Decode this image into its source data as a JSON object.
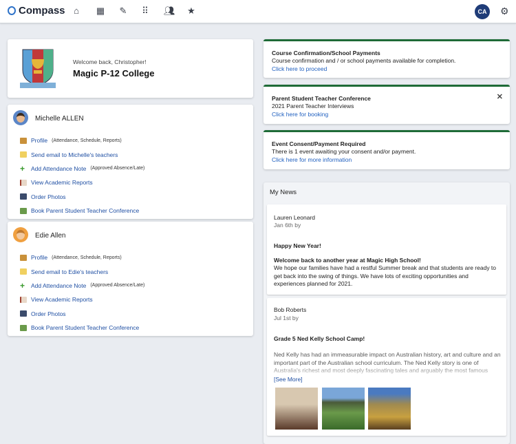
{
  "header": {
    "brand": "Compass",
    "nav_icons": [
      "home-icon",
      "calendar-icon",
      "pencil-icon",
      "apps-grid-icon",
      "people-icon",
      "star-icon"
    ],
    "avatar_initials": "CA",
    "settings_icon": "gear-icon"
  },
  "school": {
    "welcome": "Welcome back, Christopher!",
    "name": "Magic P-12 College"
  },
  "students": [
    {
      "name": "Michelle ALLEN",
      "links": [
        {
          "label": "Profile",
          "note": "(Attendance, Schedule, Reports)"
        },
        {
          "label": "Send email to Michelle's teachers",
          "note": ""
        },
        {
          "label": "Add Attendance Note",
          "note": "(Approved Absence/Late)"
        },
        {
          "label": "View Academic Reports",
          "note": ""
        },
        {
          "label": "Order Photos",
          "note": ""
        },
        {
          "label": "Book Parent Student Teacher Conference",
          "note": ""
        }
      ]
    },
    {
      "name": "Edie Allen",
      "links": [
        {
          "label": "Profile",
          "note": "(Attendance, Schedule, Reports)"
        },
        {
          "label": "Send email to Edie's teachers",
          "note": ""
        },
        {
          "label": "Add Attendance Note",
          "note": "(Approved Absence/Late)"
        },
        {
          "label": "View Academic Reports",
          "note": ""
        },
        {
          "label": "Order Photos",
          "note": ""
        },
        {
          "label": "Book Parent Student Teacher Conference",
          "note": ""
        }
      ]
    }
  ],
  "alerts": [
    {
      "title": "Course Confirmation/School Payments",
      "desc": "Course confirmation and / or school payments available for completion.",
      "link": "Click here to proceed"
    },
    {
      "title": "Parent Student Teacher Conference",
      "desc": "2021 Parent Teacher Interviews",
      "link": "Click here for booking"
    },
    {
      "title": "Event Consent/Payment Required",
      "desc": "There is 1 event awaiting your consent and/or payment.",
      "link": "Click here for more information"
    }
  ],
  "news": {
    "title": "My News",
    "items": [
      {
        "author": "Lauren Leonard",
        "date": "Jan 6th by",
        "headline": "Happy New Year!",
        "subhead": "Welcome back to another year at Magic High School!",
        "body": "We hope our families have had a restful Summer break and that students are ready to get back into the swing of things. We have lots of exciting opportunities and experiences planned for 2021."
      },
      {
        "author": "Bob Roberts",
        "date": "Jul 1st by",
        "headline": "Grade 5 Ned Kelly School Camp!",
        "body": "Ned Kelly has had an immeasurable impact on Australian history, art and culture and an important part of the Australian school curriculum. The Ned Kelly story is one of Australia's richest and most deeply fascinating tales and arguably the most famous story",
        "see_more": "[See More]"
      }
    ]
  },
  "colors": {
    "accent": "#1e6b37",
    "link": "#1f4fa3",
    "avatar": "#1f3c78"
  }
}
